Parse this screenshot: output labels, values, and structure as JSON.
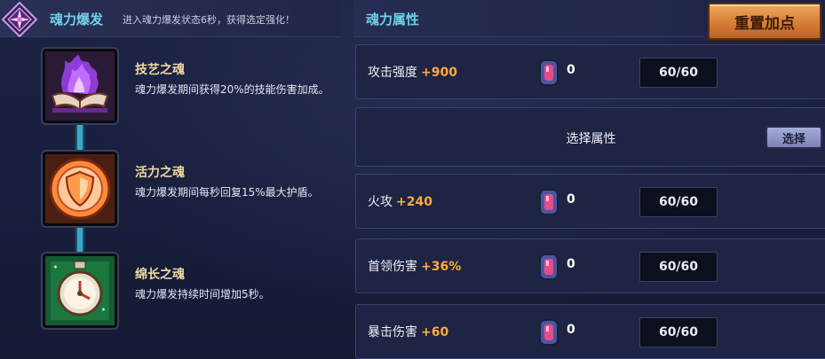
{
  "burst": {
    "title": "魂力爆发",
    "description": "进入魂力爆发状态6秒，获得选定强化！"
  },
  "souls": [
    {
      "name": "技艺之魂",
      "description": "魂力爆发期间获得20%的技能伤害加成。",
      "icon": "purple-flame-book-icon"
    },
    {
      "name": "活力之魂",
      "description": "魂力爆发期间每秒回复15%最大护盾。",
      "icon": "shield-medallion-icon"
    },
    {
      "name": "绵长之魂",
      "description": "魂力爆发持续时间增加5秒。",
      "icon": "green-stopwatch-icon"
    }
  ],
  "attributes_panel": {
    "title": "魂力属性",
    "reset_label": "重置加点",
    "select_label": "选择属性",
    "select_button": "选择",
    "rows": [
      {
        "name": "攻击强度",
        "bonus": "+900",
        "gems": "0",
        "level": "60/60"
      },
      {
        "name": "火攻",
        "bonus": "+240",
        "gems": "0",
        "level": "60/60"
      },
      {
        "name": "首领伤害",
        "bonus": "+36%",
        "gems": "0",
        "level": "60/60"
      },
      {
        "name": "暴击伤害",
        "bonus": "+60",
        "gems": "0",
        "level": "60/60"
      }
    ]
  },
  "colors": {
    "accent_title": "#6fd0e8",
    "bonus": "#ffab3a",
    "reset_button": "#d77e35",
    "connector": "#3aa9c8"
  }
}
